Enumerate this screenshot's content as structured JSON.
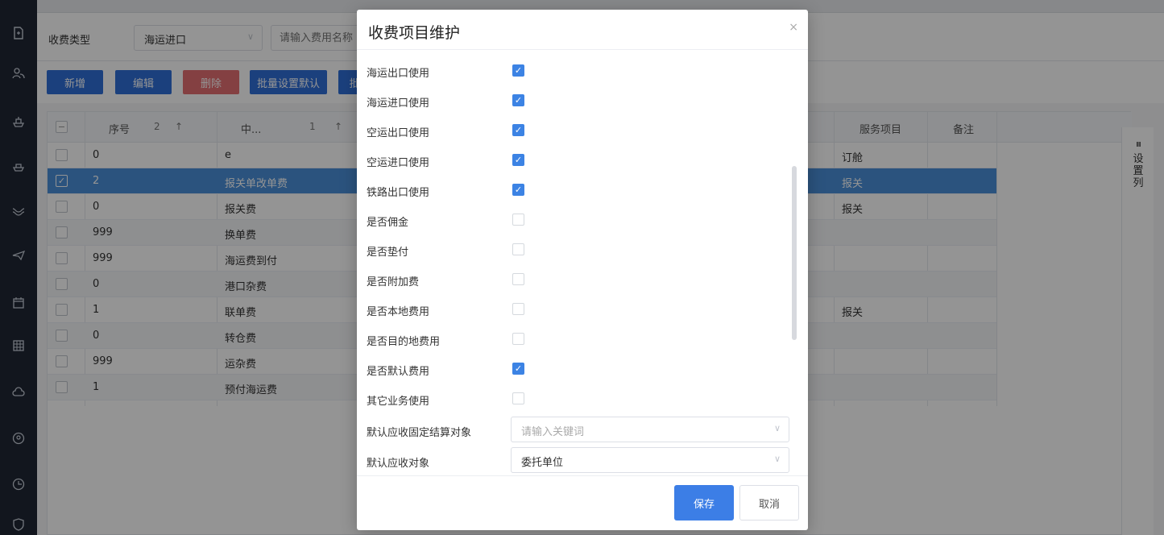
{
  "sidebar": {
    "icons": [
      "file-icon",
      "people-icon",
      "ship-icon",
      "ship-export-icon",
      "rail-icon",
      "plane-icon",
      "calendar-icon",
      "grid-icon",
      "cloud-icon",
      "user-circle-icon",
      "clock-icon",
      "shield-icon"
    ],
    "toggle": "›"
  },
  "filter": {
    "label": "收费类型",
    "type_value": "海运进口",
    "name_placeholder": "请输入费用名称"
  },
  "toolbar": {
    "add": "新增",
    "edit": "编辑",
    "delete": "删除",
    "batch_default": "批量设置默认",
    "batch_more": "批"
  },
  "table": {
    "headers": {
      "seq": "序号",
      "seq_sort": "2",
      "name": "中...",
      "name_sort": "1",
      "service": "服务项目",
      "remark": "备注",
      "arrow": "↑"
    },
    "rows": [
      {
        "seq": "0",
        "name": "e",
        "service": "订舱"
      },
      {
        "seq": "2",
        "name": "报关单改单费",
        "service": "报关"
      },
      {
        "seq": "0",
        "name": "报关费",
        "service": "报关"
      },
      {
        "seq": "999",
        "name": "换单费",
        "service": ""
      },
      {
        "seq": "999",
        "name": "海运费到付",
        "service": ""
      },
      {
        "seq": "0",
        "name": "港口杂费",
        "service": ""
      },
      {
        "seq": "1",
        "name": "联单费",
        "service": "报关"
      },
      {
        "seq": "0",
        "name": "转仓费",
        "service": ""
      },
      {
        "seq": "999",
        "name": "运杂费",
        "service": ""
      },
      {
        "seq": "1",
        "name": "预付海运费",
        "service": ""
      }
    ],
    "column_settings": "设置列",
    "column_settings_icon": "IIII"
  },
  "modal": {
    "title": "收费项目维护",
    "close": "×",
    "fields": [
      {
        "label": "海运出口使用",
        "checked": true
      },
      {
        "label": "海运进口使用",
        "checked": true
      },
      {
        "label": "空运出口使用",
        "checked": true
      },
      {
        "label": "空运进口使用",
        "checked": true
      },
      {
        "label": "铁路出口使用",
        "checked": true
      },
      {
        "label": "是否佣金",
        "checked": false
      },
      {
        "label": "是否垫付",
        "checked": false
      },
      {
        "label": "是否附加费",
        "checked": false
      },
      {
        "label": "是否本地费用",
        "checked": false
      },
      {
        "label": "是否目的地费用",
        "checked": false
      },
      {
        "label": "是否默认费用",
        "checked": true
      },
      {
        "label": "其它业务使用",
        "checked": false
      }
    ],
    "settle_label": "默认应收固定结算对象",
    "settle_placeholder": "请输入关键词",
    "receivable_label": "默认应收对象",
    "receivable_value": "委托单位",
    "save": "保存",
    "cancel": "取消"
  },
  "colors": {
    "primary": "#3c7ee6",
    "danger": "#e0575b",
    "selected_row": "#4a90d9",
    "sidebar": "#1f2634"
  }
}
